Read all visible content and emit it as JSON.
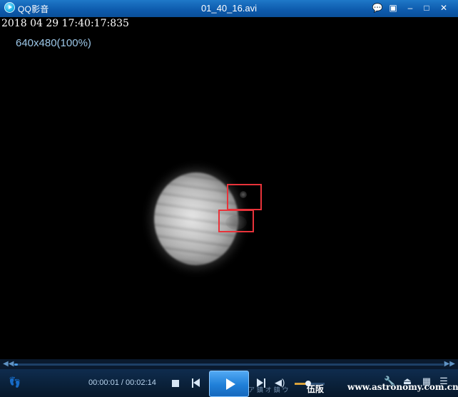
{
  "titlebar": {
    "app_name": "QQ影音",
    "file_title": "01_40_16.avi",
    "buttons": {
      "chat": "💬",
      "mini": "▣",
      "minimize": "–",
      "maximize": "□",
      "close": "✕"
    }
  },
  "video": {
    "timestamp": "2018 04 29 17:40:17:835",
    "resolution": "640x480(100%)"
  },
  "progress": {
    "seek_back": "◀◀",
    "seek_fwd": "▶▶",
    "fraction": 0.008
  },
  "controls": {
    "footprint": "👣",
    "time_current": "00:00:01",
    "time_sep": " / ",
    "time_total": "00:02:14",
    "volume_icon": "◀)",
    "volume_level": 0.45,
    "overlay_garble": "ア 鎮 オ 鎮 ウ",
    "overlay_char": "伍阪",
    "watermark": "www.astronomy.com.cn",
    "right_icons": {
      "settings": "🔧",
      "eject": "⏏",
      "skin": "▦",
      "playlist": "☰"
    }
  },
  "colors": {
    "titlebar": "#0e5cae",
    "play_button": "#1f7fd8",
    "marker": "#e8333a",
    "progress": "#4a9be6"
  }
}
